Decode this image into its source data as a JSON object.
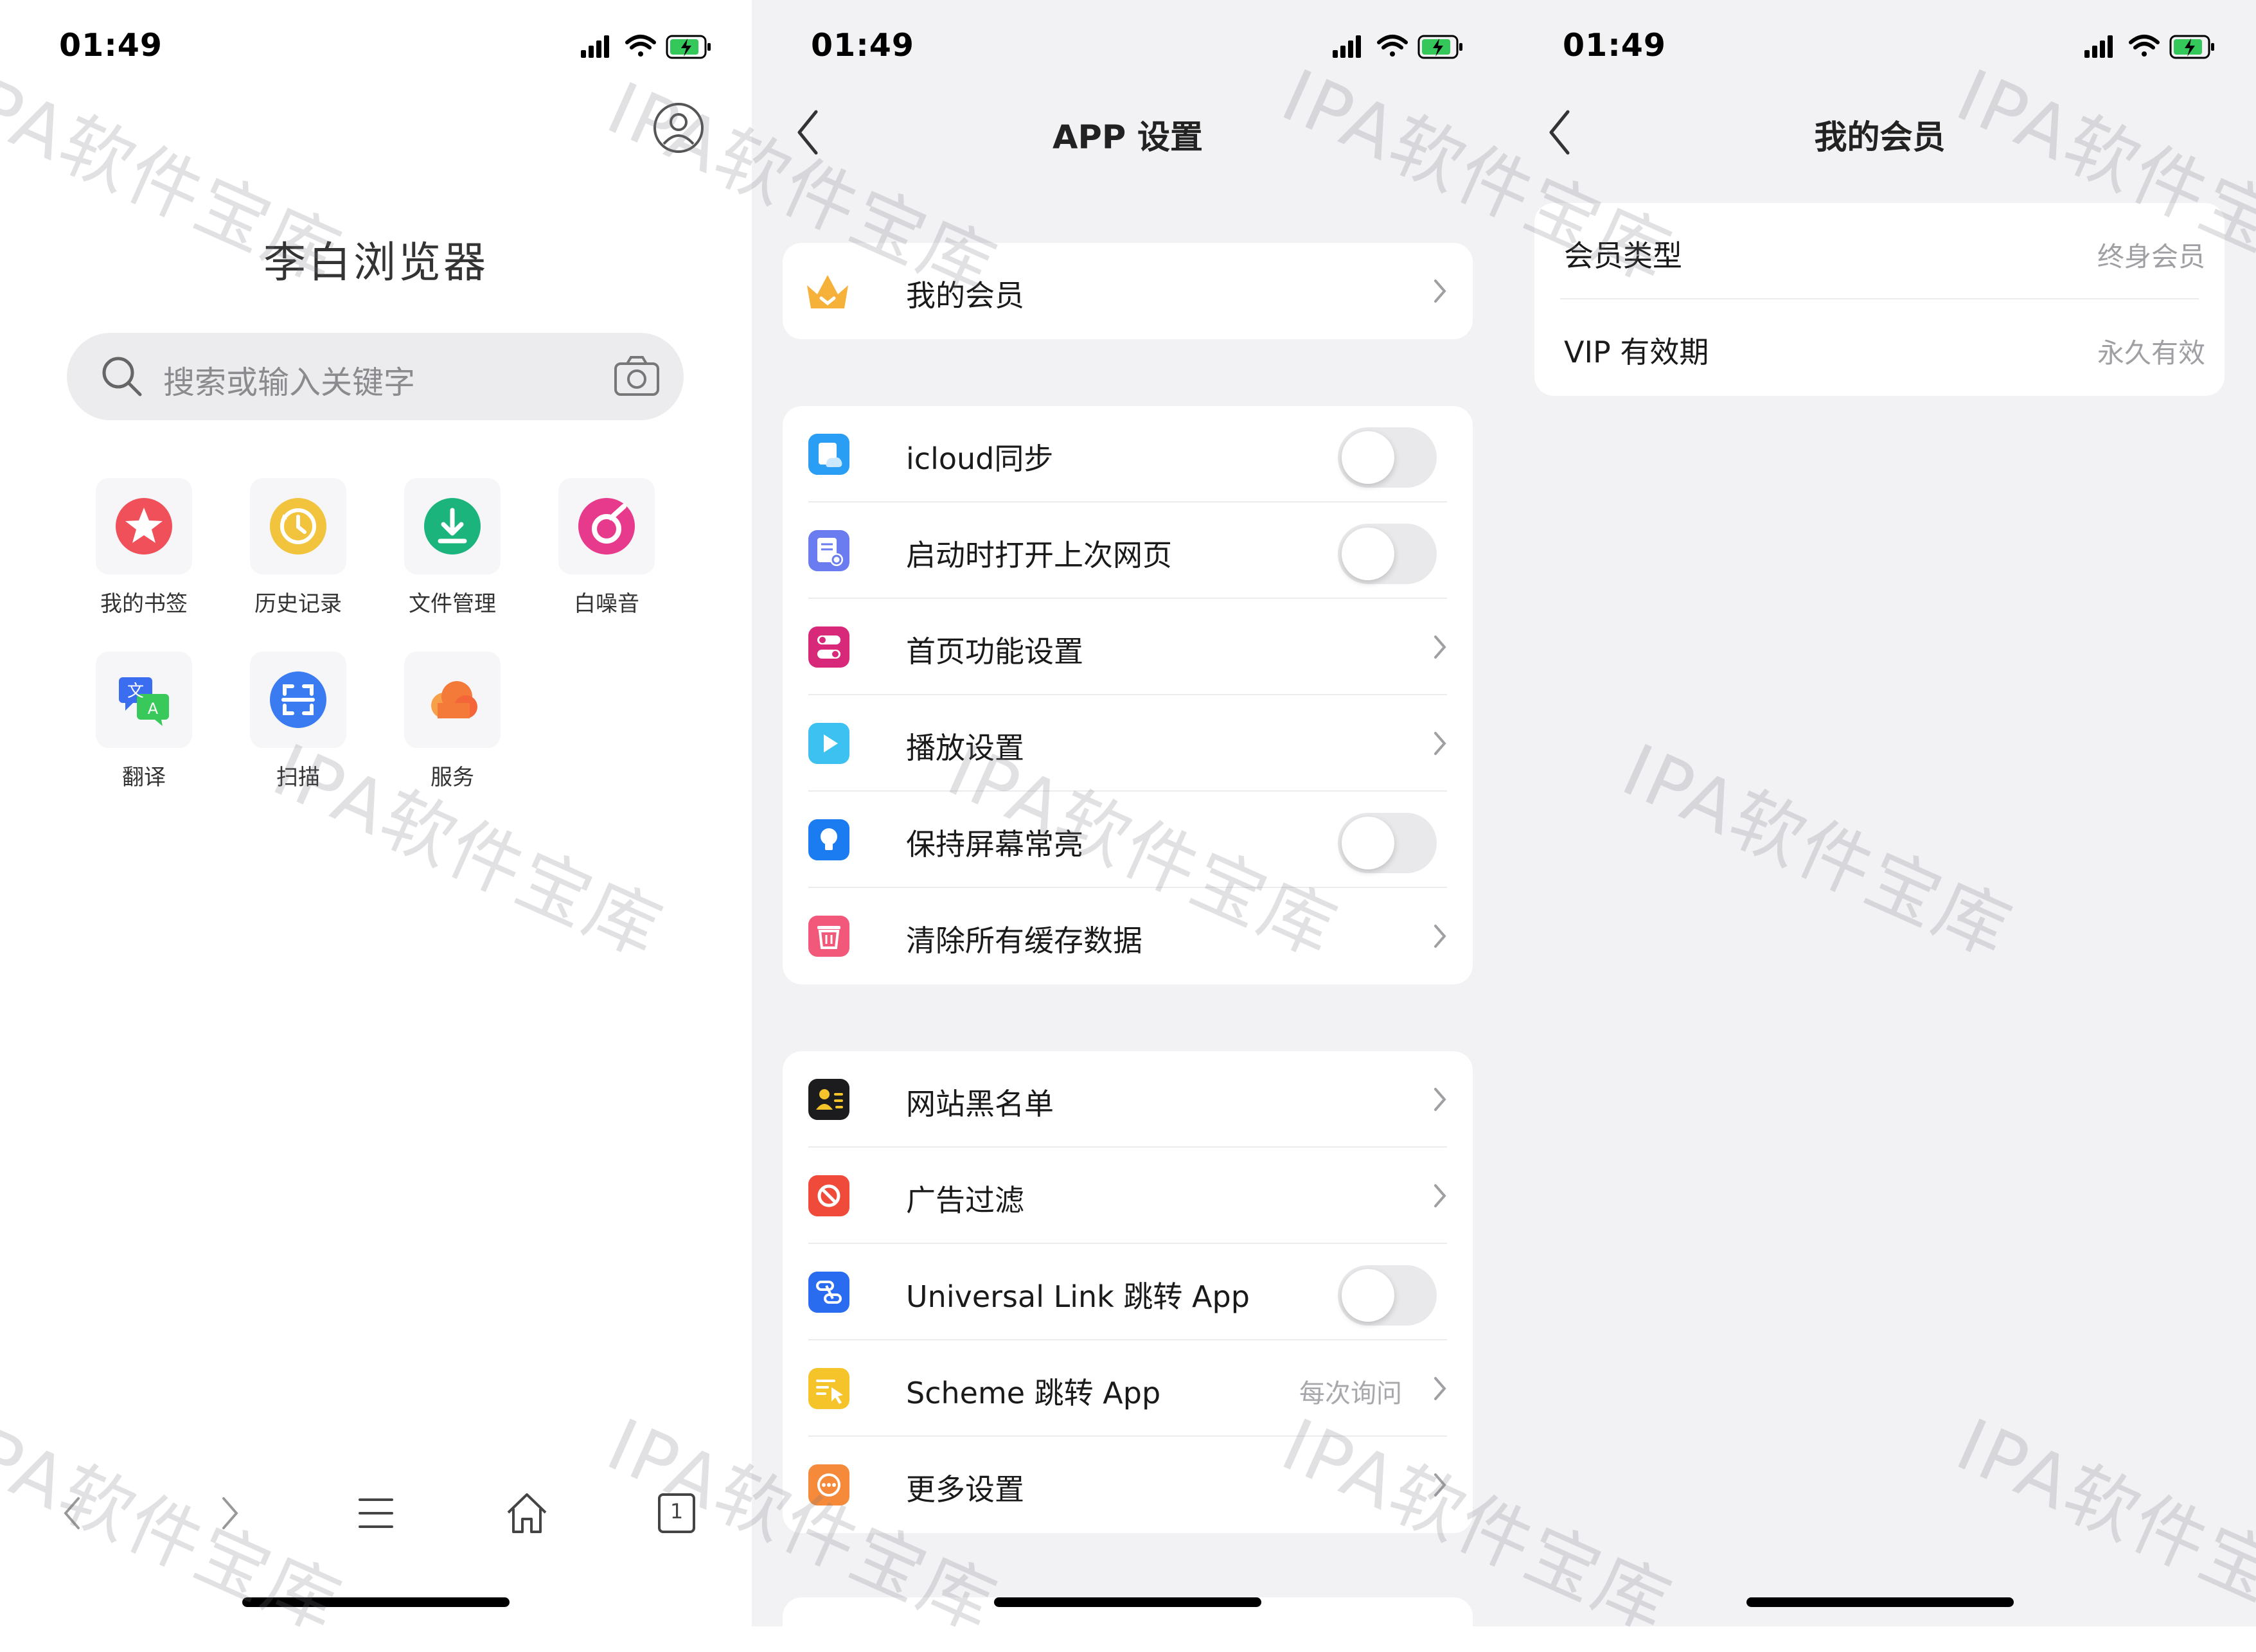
{
  "status_bar": {
    "time": "01:49"
  },
  "home": {
    "title": "李白浏览器",
    "search_placeholder": "搜索或输入关键字",
    "shortcuts": [
      {
        "label": "我的书签",
        "icon": "star-icon",
        "color": "#f0505a"
      },
      {
        "label": "历史记录",
        "icon": "history-icon",
        "color": "#f2c33c"
      },
      {
        "label": "文件管理",
        "icon": "download-icon",
        "color": "#1bb47c"
      },
      {
        "label": "白噪音",
        "icon": "music-icon",
        "color": "#e83a8c"
      },
      {
        "label": "翻译",
        "icon": "translate-icon",
        "color": "#3b6df0"
      },
      {
        "label": "扫描",
        "icon": "scan-icon",
        "color": "#3a7bf2"
      },
      {
        "label": "服务",
        "icon": "cloud-icon",
        "color": "#f47a3a"
      }
    ],
    "tab_count": "1"
  },
  "settings": {
    "title": "APP 设置",
    "membership": {
      "label": "我的会员"
    },
    "group1": [
      {
        "label": "icloud同步",
        "icon": "icloud-icon",
        "color": "#2a9df4",
        "control": "toggle",
        "on": false
      },
      {
        "label": "启动时打开上次网页",
        "icon": "restore-page-icon",
        "color": "#6a7cf0",
        "control": "toggle",
        "on": false
      },
      {
        "label": "首页功能设置",
        "icon": "home-function-icon",
        "color": "#d8287a",
        "control": "chevron"
      },
      {
        "label": "播放设置",
        "icon": "play-icon",
        "color": "#3cc1f0",
        "control": "chevron"
      },
      {
        "label": "保持屏幕常亮",
        "icon": "bulb-icon",
        "color": "#1a7cf0",
        "control": "toggle",
        "on": false
      },
      {
        "label": "清除所有缓存数据",
        "icon": "trash-icon",
        "color": "#f2587a",
        "control": "chevron"
      }
    ],
    "group2": [
      {
        "label": "网站黑名单",
        "icon": "blacklist-icon",
        "color": "#1c1c1e",
        "control": "chevron"
      },
      {
        "label": "广告过滤",
        "icon": "block-icon",
        "color": "#f04a3a",
        "control": "chevron"
      },
      {
        "label": "Universal Link 跳转 App",
        "icon": "link-icon",
        "color": "#2a6cf0",
        "control": "toggle",
        "on": false
      },
      {
        "label": "Scheme 跳转 App",
        "icon": "scheme-icon",
        "color": "#f5c32a",
        "control": "chevron",
        "value": "每次询问"
      },
      {
        "label": "更多设置",
        "icon": "more-settings-icon",
        "color": "#f58a3a",
        "control": "chevron"
      }
    ]
  },
  "membership_page": {
    "title": "我的会员",
    "rows": [
      {
        "label": "会员类型",
        "value": "终身会员"
      },
      {
        "label": "VIP 有效期",
        "value": "永久有效"
      }
    ]
  },
  "watermark": "IPA软件宝库"
}
